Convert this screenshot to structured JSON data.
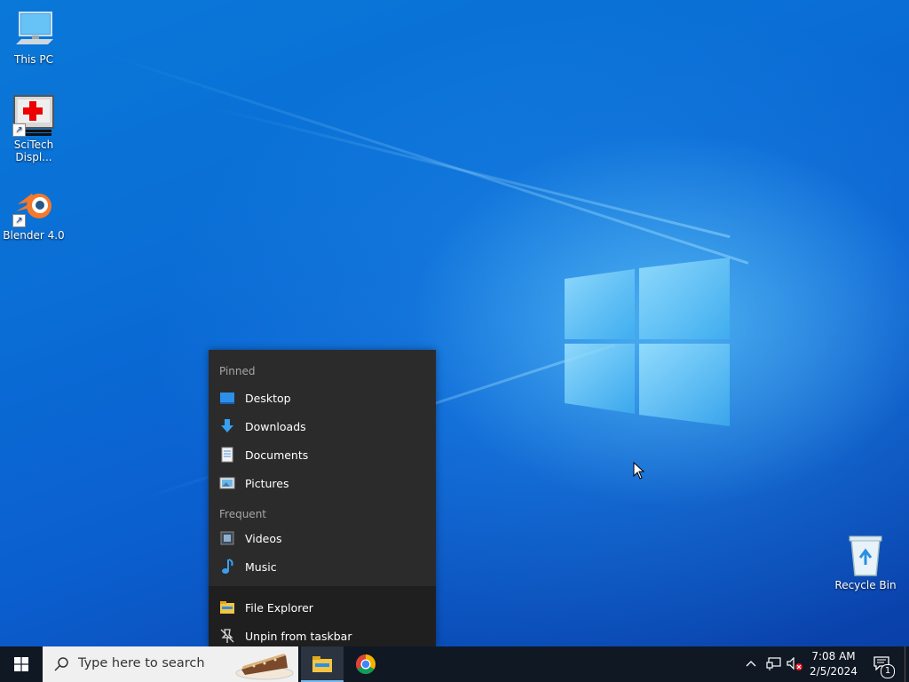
{
  "desktop": {
    "icons": [
      {
        "label": "This PC"
      },
      {
        "label": "SciTech Displ..."
      },
      {
        "label": "Blender 4.0"
      },
      {
        "label": "Recycle Bin"
      }
    ]
  },
  "jumplist": {
    "pinned_header": "Pinned",
    "pinned": [
      {
        "label": "Desktop",
        "icon": "desktop-folder-icon"
      },
      {
        "label": "Downloads",
        "icon": "downloads-arrow-icon"
      },
      {
        "label": "Documents",
        "icon": "documents-icon"
      },
      {
        "label": "Pictures",
        "icon": "pictures-icon"
      }
    ],
    "frequent_header": "Frequent",
    "frequent": [
      {
        "label": "Videos",
        "icon": "videos-icon"
      },
      {
        "label": "Music",
        "icon": "music-note-icon"
      }
    ],
    "tasks": [
      {
        "label": "File Explorer",
        "icon": "file-explorer-icon"
      },
      {
        "label": "Unpin from taskbar",
        "icon": "unpin-icon"
      }
    ]
  },
  "taskbar": {
    "search_placeholder": "Type here to search",
    "clock_time": "7:08 AM",
    "clock_date": "2/5/2024",
    "notification_count": "1"
  },
  "colors": {
    "accent": "#0078d7",
    "taskbar": "#101823",
    "jumplist_bg": "#2b2b2b"
  }
}
